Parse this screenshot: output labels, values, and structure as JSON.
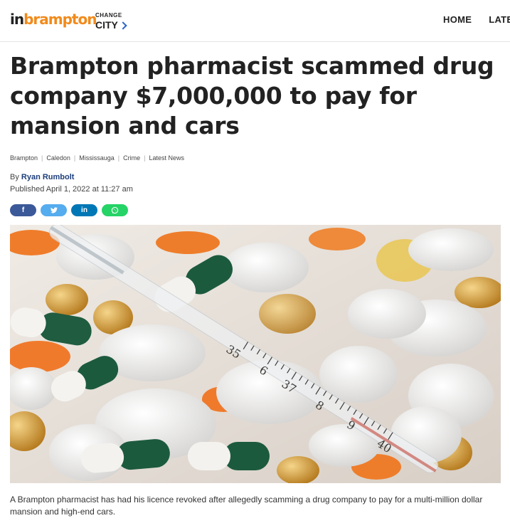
{
  "header": {
    "logo_in": "in",
    "logo_city": "brampton",
    "change_label": "CHANGE",
    "city_label": "CITY",
    "nav": [
      {
        "label": "HOME"
      },
      {
        "label": "LATEST"
      }
    ]
  },
  "article": {
    "headline": "Brampton pharmacist scammed drug company $7,000,000 to pay for mansion and cars",
    "categories": [
      "Brampton",
      "Caledon",
      "Mississauga",
      "Crime",
      "Latest News"
    ],
    "by_label": "By",
    "author": "Ryan Rumbolt",
    "published": "Published April 1, 2022 at 11:27 am",
    "share": {
      "facebook": "f",
      "twitter": "t",
      "linkedin": "in",
      "whatsapp": "whatsapp-icon"
    },
    "thermometer_labels": [
      "35",
      "6",
      "37",
      "8",
      "9",
      "40"
    ],
    "caption": "A Brampton pharmacist has had his licence revoked after allegedly scamming a drug company to pay for a multi-million dollar mansion and high-end cars."
  },
  "colors": {
    "brand_orange": "#f28a1b",
    "facebook": "#3b5998",
    "twitter": "#55acee",
    "linkedin": "#0077b5",
    "whatsapp": "#25d366"
  }
}
